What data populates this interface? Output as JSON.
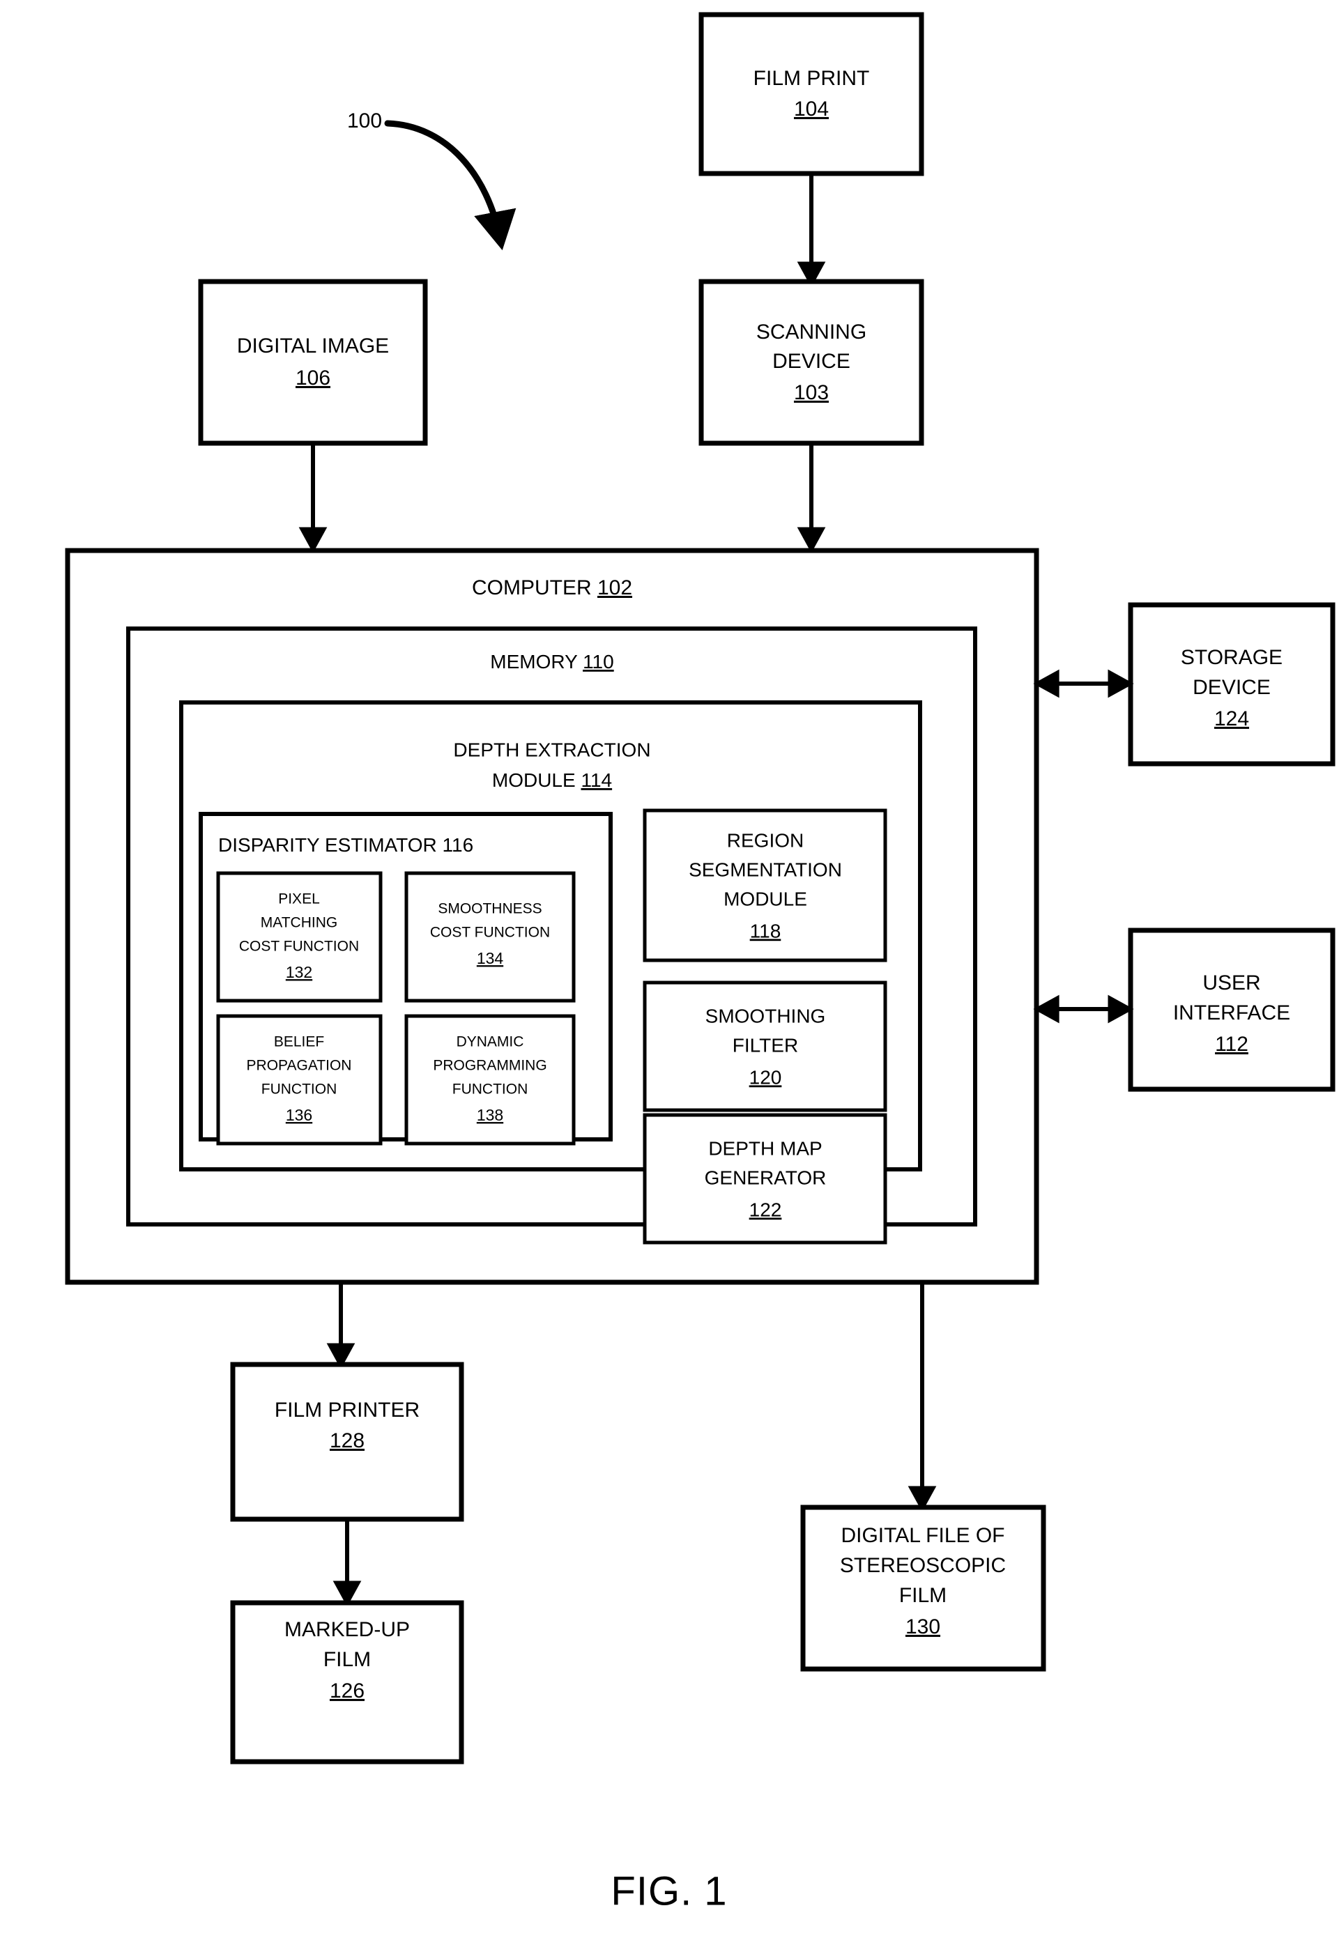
{
  "figure": {
    "caption": "FIG. 1",
    "system_ref": "100"
  },
  "boxes": {
    "film_print": {
      "line1": "FILM PRINT",
      "ref": "104"
    },
    "digital_image": {
      "line1": "DIGITAL  IMAGE",
      "ref": "106"
    },
    "scanning_device": {
      "line1": "SCANNING",
      "line2": "DEVICE",
      "ref": "103"
    },
    "computer": {
      "label": "COMPUTER",
      "ref": "102"
    },
    "memory": {
      "label": "MEMORY",
      "ref": "110"
    },
    "depth_extraction_module": {
      "line1": "DEPTH EXTRACTION",
      "line2": "MODULE",
      "ref": "114"
    },
    "disparity_estimator": {
      "label": "DISPARITY ESTIMATOR",
      "ref": "116"
    },
    "pixel_matching_cost_function": {
      "line1": "PIXEL",
      "line2": "MATCHING",
      "line3": "COST FUNCTION",
      "ref": "132"
    },
    "smoothness_cost_function": {
      "line1": "SMOOTHNESS",
      "line2": "COST FUNCTION",
      "ref": "134"
    },
    "belief_propagation_function": {
      "line1": "BELIEF",
      "line2": "PROPAGATION",
      "line3": "FUNCTION",
      "ref": "136"
    },
    "dynamic_programming_function": {
      "line1": "DYNAMIC",
      "line2": "PROGRAMMING",
      "line3": "FUNCTION",
      "ref": "138"
    },
    "region_segmentation_module": {
      "line1": "REGION",
      "line2": "SEGMENTATION",
      "line3": "MODULE",
      "ref": "118"
    },
    "smoothing_filter": {
      "line1": "SMOOTHING",
      "line2": "FILTER",
      "ref": "120"
    },
    "depth_map_generator": {
      "line1": "DEPTH MAP",
      "line2": "GENERATOR",
      "ref": "122"
    },
    "storage_device": {
      "line1": "STORAGE",
      "line2": "DEVICE",
      "ref": "124"
    },
    "user_interface": {
      "line1": "USER",
      "line2": "INTERFACE",
      "ref": "112"
    },
    "film_printer": {
      "line1": "FILM PRINTER",
      "ref": "128"
    },
    "marked_up_film": {
      "line1": "MARKED-UP",
      "line2": "FILM",
      "ref": "126"
    },
    "digital_file_stereoscopic_film": {
      "line1": "DIGITAL FILE OF",
      "line2": "STEREOSCOPIC",
      "line3": "FILM",
      "ref": "130"
    }
  },
  "colors": {
    "stroke": "#000000",
    "fill": "#ffffff"
  }
}
